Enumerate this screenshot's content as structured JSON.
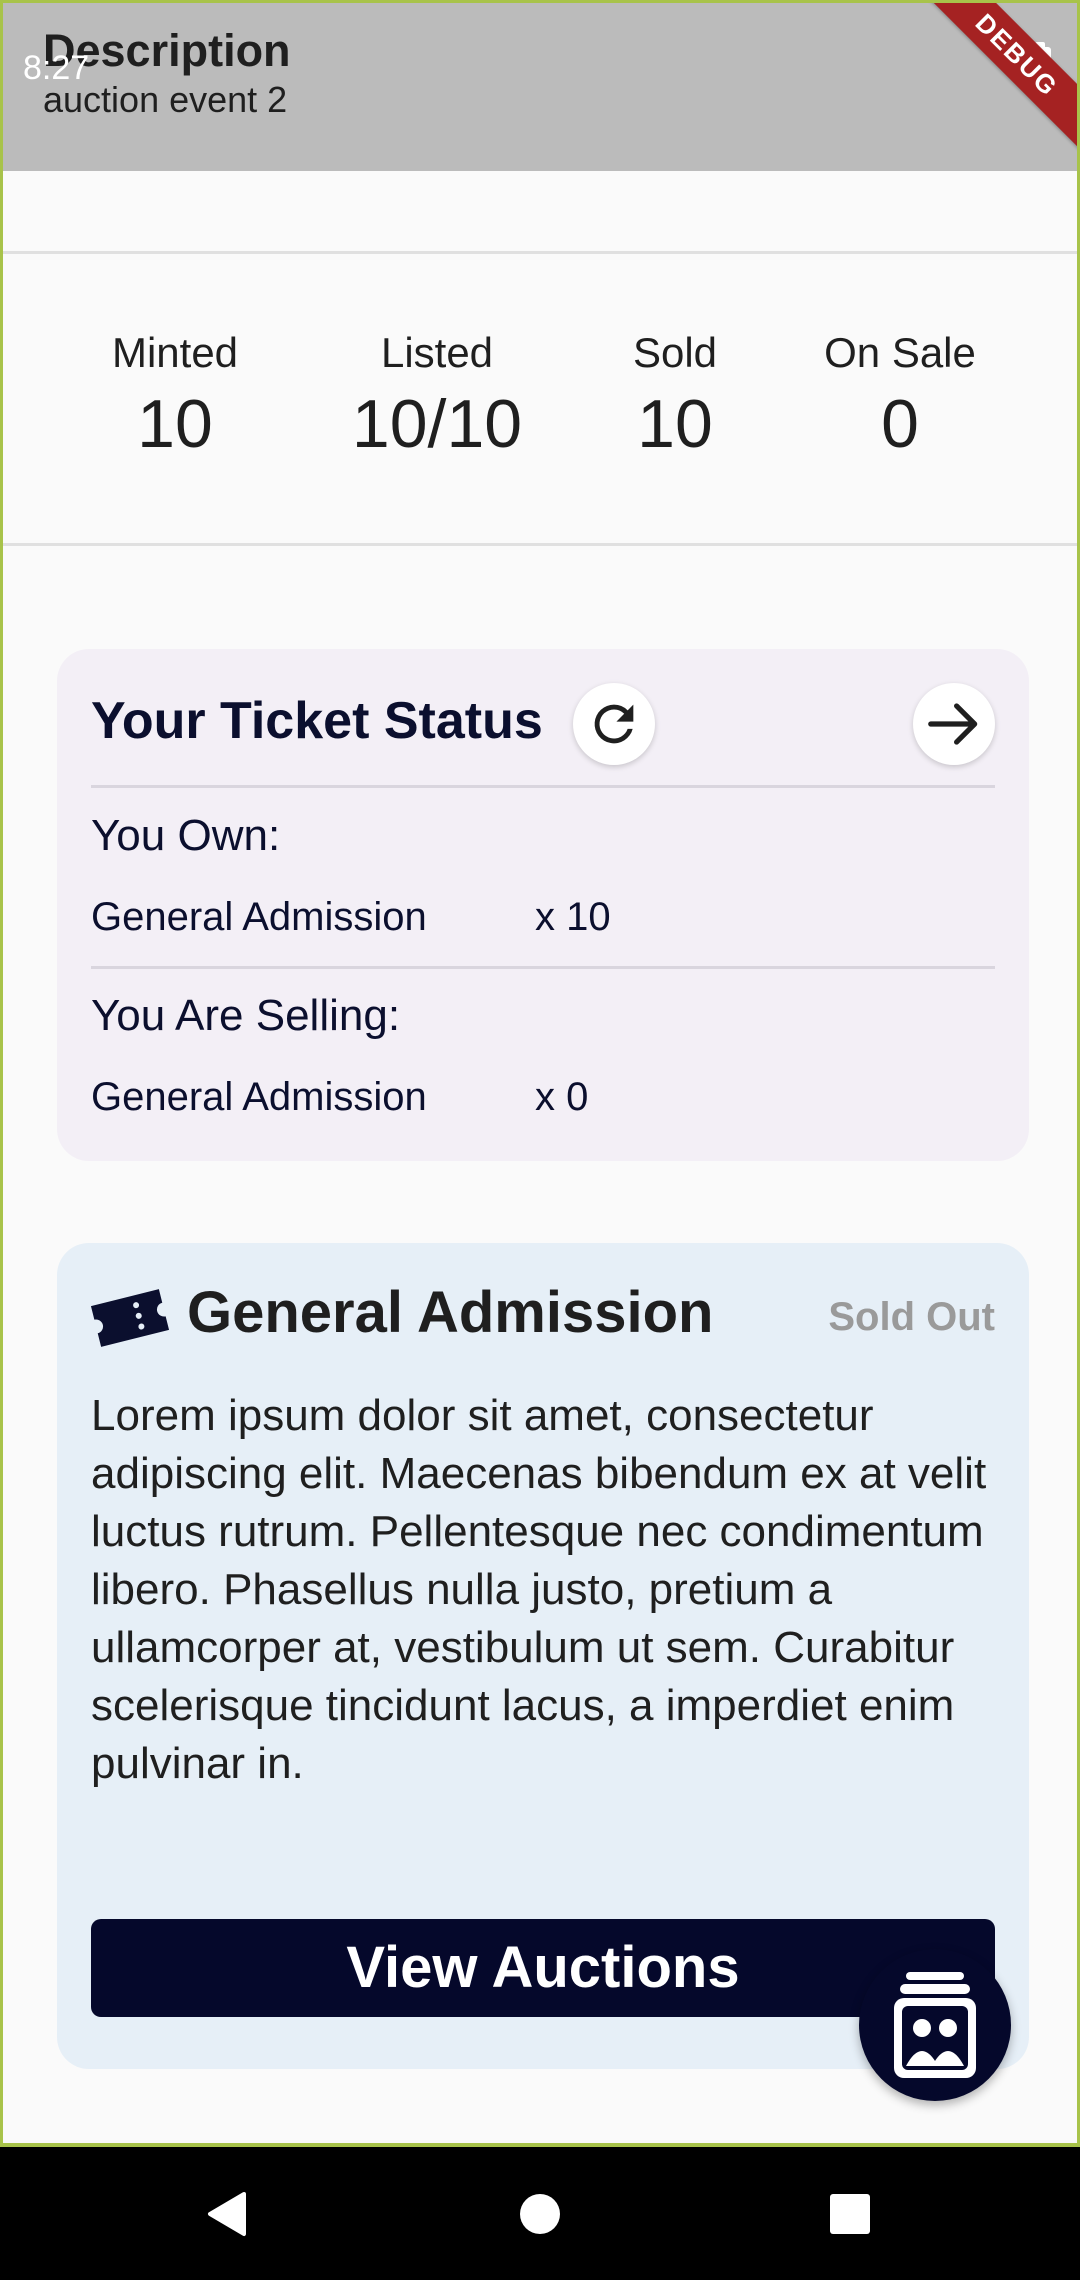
{
  "status_bar": {
    "time": "8:27",
    "battery_icon": "battery-icon"
  },
  "app_bar": {
    "title": "Description",
    "subtitle": "auction event 2",
    "debug_label": "DEBUG"
  },
  "stats": [
    {
      "label": "Minted",
      "value": "10"
    },
    {
      "label": "Listed",
      "value": "10/10"
    },
    {
      "label": "Sold",
      "value": "10"
    },
    {
      "label": "On Sale",
      "value": "0"
    }
  ],
  "ticket_status": {
    "heading": "Your Ticket Status",
    "refresh_icon": "refresh-icon",
    "arrow_icon": "arrow-right-icon",
    "own_label": "You Own:",
    "own_rows": [
      {
        "name": "General Admission",
        "qty": "x 10"
      }
    ],
    "selling_label": "You Are Selling:",
    "selling_rows": [
      {
        "name": "General Admission",
        "qty": "x 0"
      }
    ]
  },
  "ticket_type": {
    "icon": "ticket-icon",
    "title": "General Admission",
    "badge": "Sold Out",
    "description": "Lorem ipsum dolor sit amet, consectetur adipiscing elit. Maecenas bibendum ex at velit luctus rutrum. Pellentesque nec condimentum libero. Phasellus nulla justo, pretium a ullamcorper at, vestibulum ut sem. Curabitur scelerisque tincidunt lacus, a imperdiet enim pulvinar in.",
    "button_label": "View Auctions"
  },
  "fab": {
    "icon": "wallet-people-icon"
  },
  "nav": {
    "back_icon": "back-triangle-icon",
    "home_icon": "home-circle-icon",
    "recents_icon": "recents-square-icon"
  },
  "colors": {
    "primary": "#05082b",
    "appbar": "#bbbbbb",
    "status_card": "#f3eff6",
    "ticket_card": "#e6eff7",
    "debug_banner": "#a52222",
    "muted": "#9a9a9a"
  }
}
